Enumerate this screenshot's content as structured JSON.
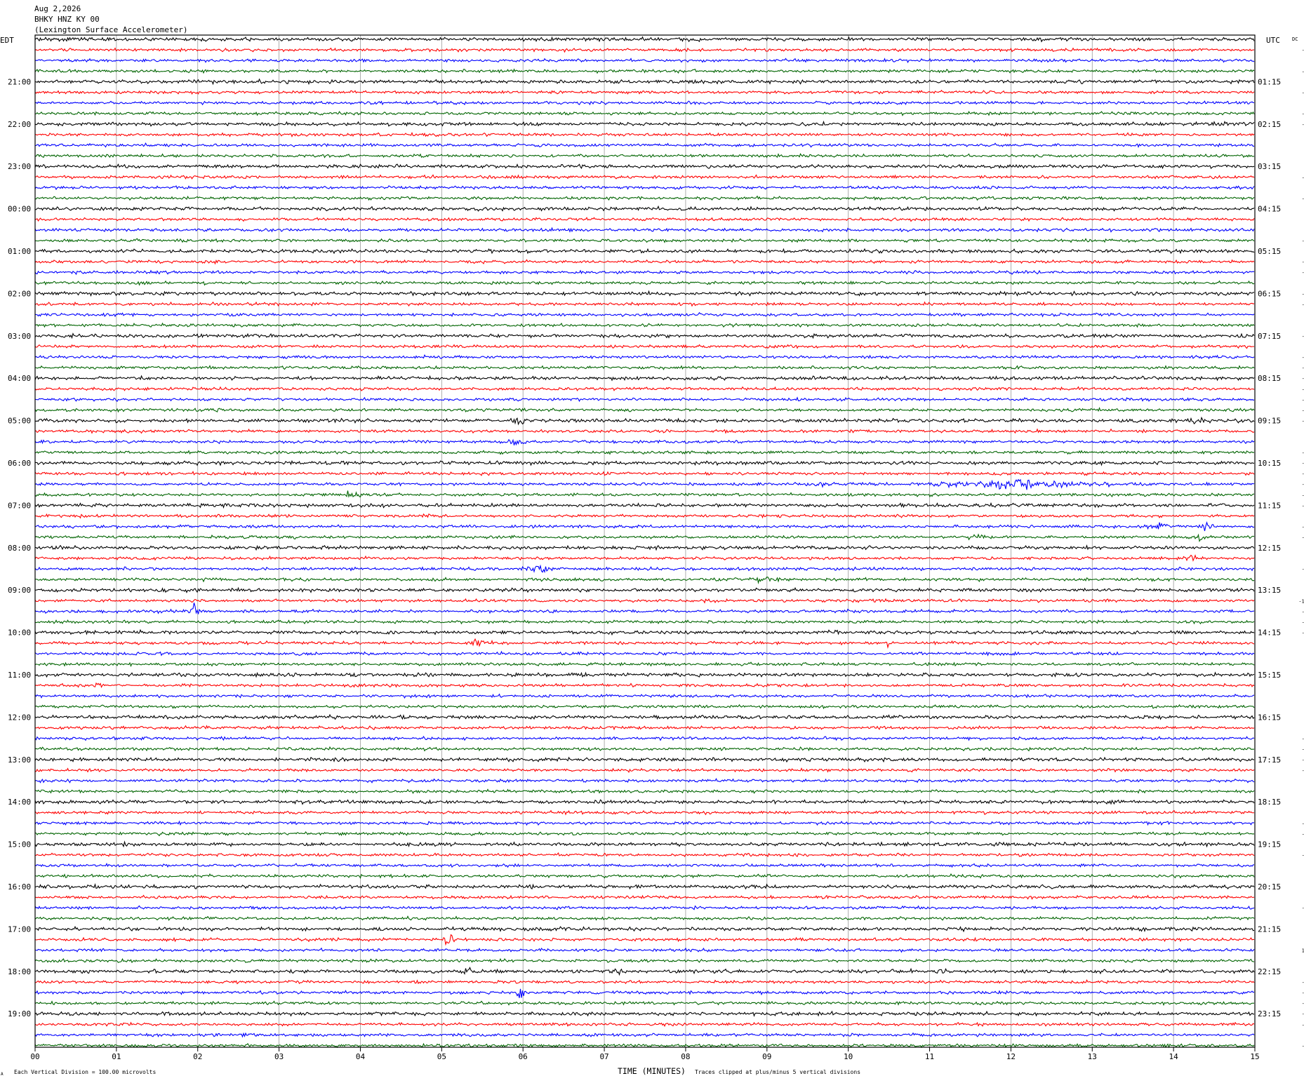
{
  "header": {
    "date": "Aug 2,2026",
    "station": "BHKY HNZ KY 00",
    "site": "(Lexington Surface Accelerometer)"
  },
  "labels": {
    "left_zone": "EDT",
    "right_zone": "UTC",
    "dc_label": "DC",
    "xlabel": "TIME (MINUTES)",
    "scale_note": "Each Vertical Division =  100.00 microvolts",
    "clip_note": "Traces clipped at plus/minus 5 vertical divisions",
    "corner_mark": "A"
  },
  "chart_data": {
    "type": "line",
    "title": "BHKY HNZ KY 00",
    "xlabel": "TIME (MINUTES)",
    "xlim": [
      0,
      15
    ],
    "x_ticks": [
      "00",
      "01",
      "02",
      "03",
      "04",
      "05",
      "06",
      "07",
      "08",
      "09",
      "10",
      "11",
      "12",
      "13",
      "14",
      "15"
    ],
    "rows_per_hour": 4,
    "row_count": 96,
    "trace_colors": [
      "#000000",
      "#ff0000",
      "#0000ff",
      "#006400"
    ],
    "left_hour_labels": [
      "21:00",
      "22:00",
      "23:00",
      "00:00",
      "01:00",
      "02:00",
      "03:00",
      "04:00",
      "05:00",
      "06:00",
      "07:00",
      "08:00",
      "09:00",
      "10:00",
      "11:00",
      "12:00",
      "13:00",
      "14:00",
      "15:00",
      "16:00",
      "17:00",
      "18:00",
      "19:00"
    ],
    "right_hour_labels": [
      "01:15",
      "02:15",
      "03:15",
      "04:15",
      "05:15",
      "06:15",
      "07:15",
      "08:15",
      "09:15",
      "10:15",
      "11:15",
      "12:15",
      "13:15",
      "14:15",
      "15:15",
      "16:15",
      "17:15",
      "18:15",
      "19:15",
      "20:15",
      "21:15",
      "22:15",
      "23:15"
    ],
    "dc_offsets": [
      "1",
      "-7",
      "8",
      "-4",
      "0",
      "-2",
      "4",
      "-1",
      "-1",
      "8",
      "3",
      "0",
      "4",
      "-7",
      "3",
      "-6",
      "3",
      "1",
      "1",
      "-7",
      "9",
      "-1",
      "-3",
      "4",
      "-1",
      "-4",
      "1",
      "4",
      "-4",
      "0",
      "-0",
      "-7",
      "-1",
      "-2",
      "-1",
      "-2",
      "-5",
      "1",
      "8",
      "-8",
      "-5",
      "-2",
      "-1",
      "-3",
      "-5",
      "0",
      "-9",
      "-8",
      "9",
      "6",
      "-2",
      "1",
      "8",
      "-14",
      "-3",
      "-0",
      "-6",
      "2",
      "2",
      "9",
      "3",
      "0",
      "5",
      "4",
      "3",
      "1",
      "-3",
      "-0",
      "-6",
      "-1",
      "3",
      "2",
      "1",
      "2",
      "-5",
      "-4",
      "3",
      "-4",
      "1",
      "1",
      "1",
      "8",
      "-3",
      "1",
      "1",
      "9",
      "11",
      "2",
      "1",
      "-2",
      "-0",
      "-1",
      "-1",
      "-3",
      "1",
      "-7"
    ],
    "events": [
      {
        "row": 36,
        "minute": 5.95,
        "amp": 2.0,
        "width": 0.15
      },
      {
        "row": 36,
        "minute": 14.3,
        "amp": 1.5,
        "width": 0.15
      },
      {
        "row": 38,
        "minute": 5.9,
        "amp": 1.6,
        "width": 0.2
      },
      {
        "row": 42,
        "minute": 9.6,
        "amp": 1.8,
        "width": 0.15
      },
      {
        "row": 42,
        "minute": 12.0,
        "amp": 1.6,
        "width": 1.4
      },
      {
        "row": 43,
        "minute": 3.9,
        "amp": 1.6,
        "width": 0.15
      },
      {
        "row": 46,
        "minute": 13.8,
        "amp": 1.8,
        "width": 0.2
      },
      {
        "row": 46,
        "minute": 14.4,
        "amp": 2.6,
        "width": 0.15
      },
      {
        "row": 47,
        "minute": 11.6,
        "amp": 1.5,
        "width": 0.15
      },
      {
        "row": 47,
        "minute": 14.3,
        "amp": 1.6,
        "width": 0.15
      },
      {
        "row": 49,
        "minute": 14.2,
        "amp": 1.5,
        "width": 0.15
      },
      {
        "row": 50,
        "minute": 6.2,
        "amp": 1.7,
        "width": 0.25
      },
      {
        "row": 51,
        "minute": 9.0,
        "amp": 1.7,
        "width": 0.25
      },
      {
        "row": 54,
        "minute": 1.95,
        "amp": 3.0,
        "width": 0.08
      },
      {
        "row": 57,
        "minute": 5.5,
        "amp": 2.4,
        "width": 0.15
      },
      {
        "row": 57,
        "minute": 10.5,
        "amp": 2.6,
        "width": 0.06
      },
      {
        "row": 61,
        "minute": 0.8,
        "amp": 2.0,
        "width": 0.08
      },
      {
        "row": 85,
        "minute": 5.1,
        "amp": 4.5,
        "width": 0.1
      },
      {
        "row": 88,
        "minute": 5.3,
        "amp": 1.6,
        "width": 0.15
      },
      {
        "row": 88,
        "minute": 7.15,
        "amp": 1.8,
        "width": 0.1
      },
      {
        "row": 88,
        "minute": 11.15,
        "amp": 1.7,
        "width": 0.1
      },
      {
        "row": 90,
        "minute": 5.98,
        "amp": 5.0,
        "width": 0.08
      }
    ]
  }
}
